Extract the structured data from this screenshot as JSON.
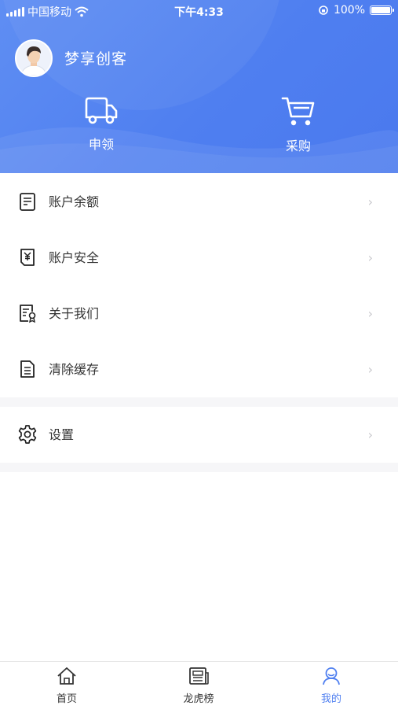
{
  "status_bar": {
    "carrier": "中国移动",
    "time": "下午4:33",
    "battery": "100%"
  },
  "profile": {
    "name": "梦享创客"
  },
  "quick_actions": [
    {
      "label": "申领",
      "icon": "truck-icon"
    },
    {
      "label": "采购",
      "icon": "cart-icon"
    }
  ],
  "menu": {
    "chevron": "›",
    "items": [
      {
        "label": "账户余额",
        "icon": "ledger-icon"
      },
      {
        "label": "账户安全",
        "icon": "yuan-document-icon"
      },
      {
        "label": "关于我们",
        "icon": "certificate-icon"
      },
      {
        "label": "清除缓存",
        "icon": "document-icon"
      }
    ],
    "settings": {
      "label": "设置",
      "icon": "gear-icon"
    }
  },
  "tabbar": {
    "tabs": [
      {
        "label": "首页",
        "icon": "home-icon"
      },
      {
        "label": "龙虎榜",
        "icon": "newspaper-icon"
      },
      {
        "label": "我的",
        "icon": "person-icon",
        "active": true
      }
    ],
    "active_color": "#4f7ff0"
  },
  "colors": {
    "header": "#5584f2",
    "text": "#333333",
    "chevron": "#c7c7cc",
    "divider_bg": "#f6f6f8"
  }
}
